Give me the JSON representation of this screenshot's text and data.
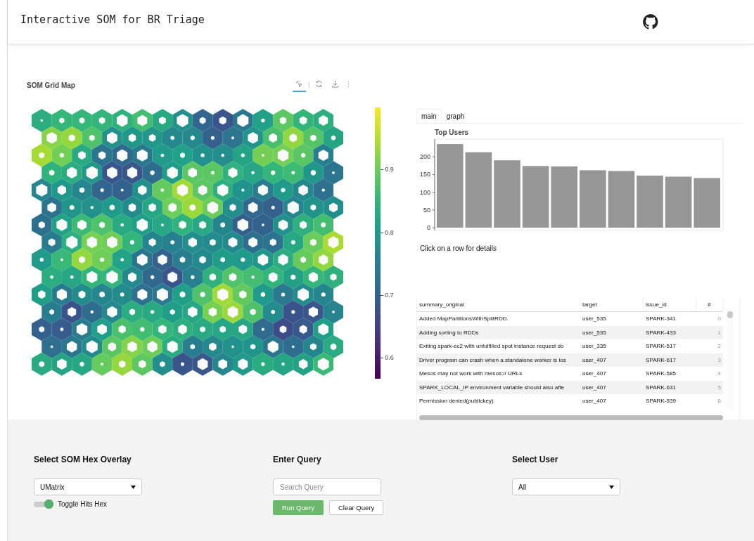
{
  "header": {
    "title": "Interactive SOM for BR Triage"
  },
  "som_panel": {
    "title": "SOM Grid Map",
    "modebar": [
      {
        "kind": "select",
        "selected": true
      },
      {
        "kind": "reset",
        "selected": false
      },
      {
        "kind": "download",
        "selected": false
      },
      {
        "kind": "more",
        "selected": false
      }
    ],
    "colorbar_ticks": [
      "0.9",
      "0.8",
      "0.7",
      "0.6"
    ]
  },
  "tabs": [
    {
      "label": "main",
      "selected": true
    },
    {
      "label": "graph",
      "selected": false
    }
  ],
  "top_users": {
    "chart_data": {
      "type": "bar",
      "title": "Top Users",
      "categories": [
        null,
        null,
        null,
        null,
        null,
        null,
        null,
        null,
        null,
        null
      ],
      "series": [
        {
          "color": "#969696",
          "values": [
            236,
            213,
            190,
            174,
            173,
            162,
            160,
            147,
            144,
            140
          ]
        }
      ],
      "ylim": [
        0,
        250
      ],
      "yticks": [
        {
          "value": 0,
          "label": "0"
        },
        {
          "value": 50,
          "label": "50"
        },
        {
          "value": 100,
          "label": "100"
        },
        {
          "value": 150,
          "label": "150"
        },
        {
          "value": 200,
          "label": "200"
        }
      ]
    }
  },
  "hint": "Click on a row for details",
  "table": {
    "columns": [
      "summary_original",
      "target",
      "issue_id",
      "#"
    ],
    "rows": [
      {
        "summary_original": "Added MapPartitionsWithSplitRDD.",
        "target": "user_535",
        "issue_id": "SPARK-341",
        "index": "0"
      },
      {
        "summary_original": "Adding sorting to RDDs",
        "target": "user_535",
        "issue_id": "SPARK-433",
        "index": "1"
      },
      {
        "summary_original": "Exiting spark-ec2 with unfulfilled spot instance request do",
        "target": "user_335",
        "issue_id": "SPARK-517",
        "index": "2"
      },
      {
        "summary_original": "Driver program can crash when a standalone worker is los",
        "target": "user_407",
        "issue_id": "SPARK-617",
        "index": "3"
      },
      {
        "summary_original": "Mesos may not work with mesos:// URLs",
        "target": "user_407",
        "issue_id": "SPARK-585",
        "index": "4"
      },
      {
        "summary_original": "SPARK_LOCAL_IP environment variable should also affe",
        "target": "user_407",
        "issue_id": "SPARK-631",
        "index": "5"
      },
      {
        "summary_original": "Permission denied(publickey)",
        "target": "user_407",
        "issue_id": "SPARK-539",
        "index": "6"
      }
    ]
  },
  "controls": {
    "overlay": {
      "title": "Select SOM Hex Overlay",
      "value": "UMatrix",
      "toggle": {
        "label": "Toggle Hits Hex",
        "on": true
      }
    },
    "query": {
      "title": "Enter Query",
      "placeholder": "Search Query",
      "buttons": [
        {
          "label": "Run Query",
          "kind": "primary"
        },
        {
          "label": "Clear Query",
          "kind": "secondary"
        }
      ]
    },
    "user": {
      "title": "Select User",
      "value": "All"
    }
  }
}
